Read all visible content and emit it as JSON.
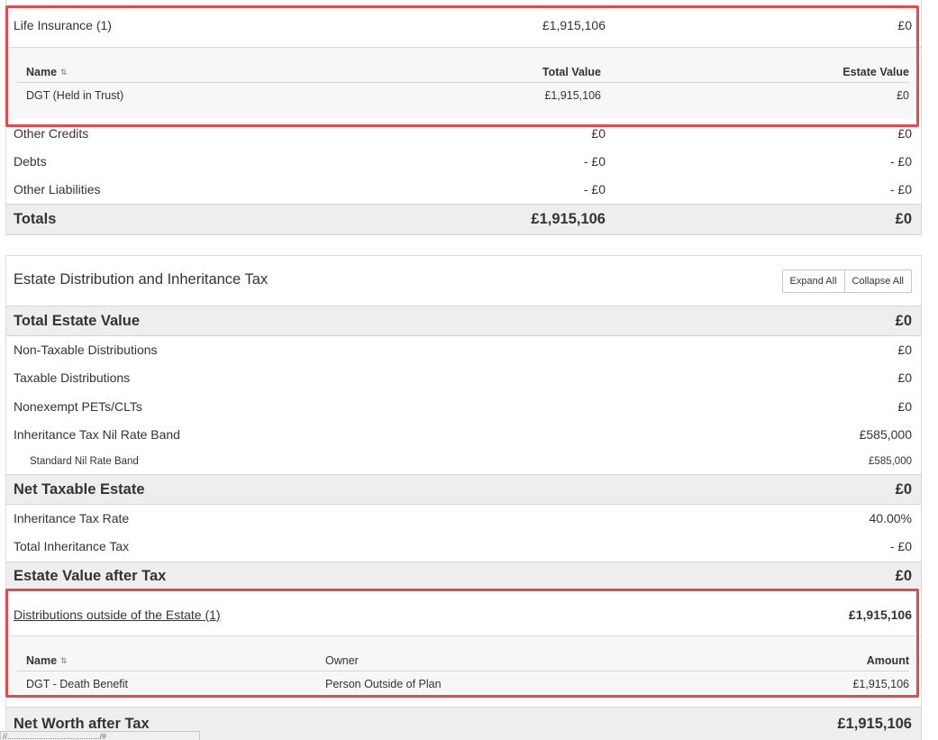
{
  "top_panel": {
    "life_insurance": {
      "label": "Life Insurance (1)",
      "total": "£1,915,106",
      "estate": "£0",
      "table": {
        "headers": {
          "name": "Name",
          "total": "Total Value",
          "estate": "Estate Value"
        },
        "rows": [
          {
            "name": "DGT (Held in Trust)",
            "total": "£1,915,106",
            "estate": "£0"
          }
        ]
      }
    },
    "other_credits": {
      "label": "Other Credits",
      "total": "£0",
      "estate": "£0"
    },
    "debts": {
      "label": "Debts",
      "total": "- £0",
      "estate": "- £0"
    },
    "other_liabilities": {
      "label": "Other Liabilities",
      "total": "- £0",
      "estate": "- £0"
    },
    "totals": {
      "label": "Totals",
      "total": "£1,915,106",
      "estate": "£0"
    }
  },
  "distribution_panel": {
    "title": "Estate Distribution and Inheritance Tax",
    "expand_all": "Expand All",
    "collapse_all": "Collapse All",
    "total_estate_value": {
      "label": "Total Estate Value",
      "value": "£0"
    },
    "non_taxable": {
      "label": "Non-Taxable Distributions",
      "value": "£0"
    },
    "taxable": {
      "label": "Taxable Distributions",
      "value": "£0"
    },
    "nonexempt": {
      "label": "Nonexempt PETs/CLTs",
      "value": "£0"
    },
    "nil_rate_band": {
      "label": "Inheritance Tax Nil Rate Band",
      "value": "£585,000"
    },
    "standard_nil_rate_band": {
      "label": "Standard Nil Rate Band",
      "value": "£585,000"
    },
    "net_taxable_estate": {
      "label": "Net Taxable Estate",
      "value": "£0"
    },
    "tax_rate": {
      "label": "Inheritance Tax Rate",
      "value": "40.00%"
    },
    "total_tax": {
      "label": "Total Inheritance Tax",
      "value": "- £0"
    },
    "estate_after_tax": {
      "label": "Estate Value after Tax",
      "value": "£0"
    },
    "outside_estate": {
      "label": "Distributions outside of the Estate (1)",
      "value": "£1,915,106",
      "table": {
        "headers": {
          "name": "Name",
          "owner": "Owner",
          "amount": "Amount"
        },
        "rows": [
          {
            "name": "DGT - Death Benefit",
            "owner": "Person Outside of Plan",
            "amount": "£1,915,106"
          }
        ]
      }
    },
    "net_worth_after_tax": {
      "label": "Net Worth after Tax",
      "value": "£1,915,106"
    }
  },
  "status_bar": {
    "text": "//........................................./#"
  },
  "colors": {
    "highlight": "#e34a4f",
    "shaded_row": "#eeeeee",
    "subtable_bg": "#f7f7f7"
  },
  "icons": {
    "sort": "sort-icon"
  }
}
